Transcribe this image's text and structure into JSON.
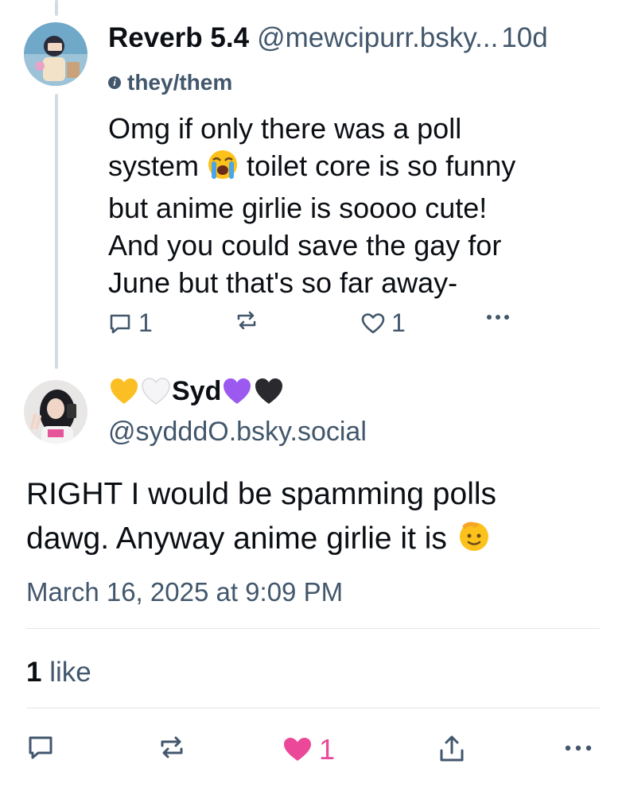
{
  "parent_post": {
    "display_name": "Reverb 5.4",
    "handle": "@mewcipurr.bsky...",
    "age": "10d",
    "pronouns": "they/them",
    "text_lines": [
      "Omg if only there was a poll",
      "toilet core is so funny",
      "but anime girlie is soooo cute!",
      "And you could save the gay for",
      "June but that's so far away-"
    ],
    "line2_prefix": "system",
    "reply_count": "1",
    "like_count": "1"
  },
  "reply_post": {
    "display_name": "Syd",
    "handle": "@sydddO.bsky.social",
    "text_line1": "RIGHT I would be spamming polls",
    "text_line2": "dawg. Anyway anime girlie it is",
    "timestamp": "March 16, 2025 at 9:09 PM",
    "likes_count": "1",
    "likes_label": "like",
    "like_button_count": "1"
  },
  "icons": {
    "reply": "reply-icon",
    "repost": "repost-icon",
    "like": "heart-icon",
    "share": "share-icon",
    "more": "more-icon",
    "crying_emoji": "loudly-crying-face-emoji",
    "salute_emoji": "saluting-face-emoji"
  },
  "colors": {
    "text": "#0b0f14",
    "muted": "#42576c",
    "liked_pink": "#ec4899",
    "thread_line": "#d4dbe2"
  }
}
